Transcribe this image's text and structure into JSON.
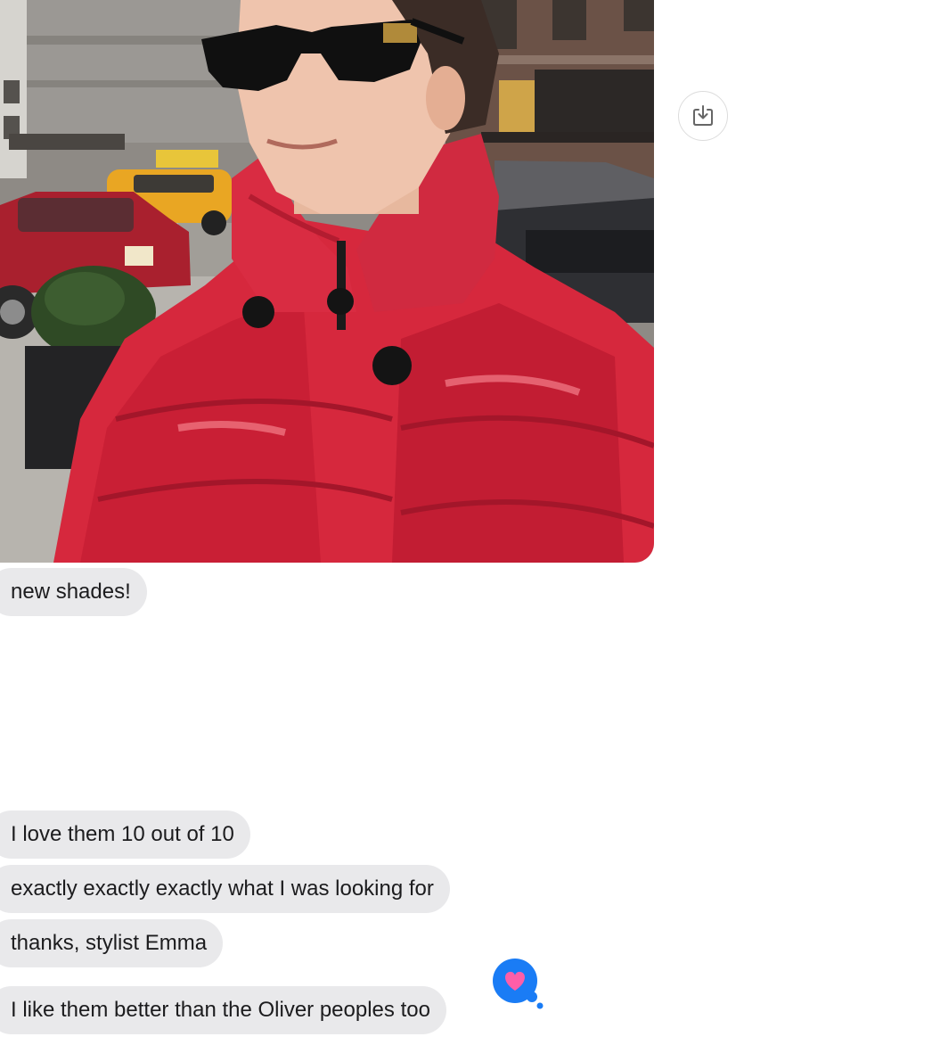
{
  "attachment": {
    "type": "photo",
    "download_icon": "download-icon"
  },
  "messages": [
    {
      "text": "new shades!"
    },
    {
      "text": "I love them 10 out of 10"
    },
    {
      "text": "exactly exactly exactly what I was looking for"
    },
    {
      "text": "thanks, stylist Emma"
    },
    {
      "text": "I like them better than the Oliver peoples too"
    }
  ],
  "reaction": {
    "icon": "heart-icon",
    "color": "#1a7cf5",
    "heart_color": "#ff5ea8"
  },
  "colors": {
    "bubble_bg": "#e9e9eb",
    "text": "#1c1c1e"
  }
}
